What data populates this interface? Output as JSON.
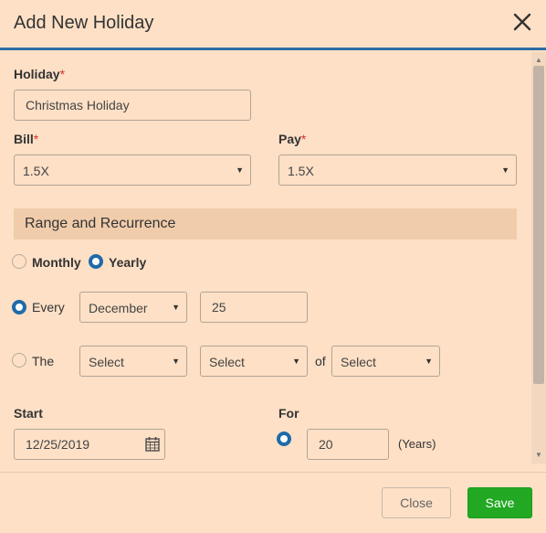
{
  "dialog": {
    "title": "Add New Holiday"
  },
  "holiday": {
    "label": "Holiday",
    "required_mark": "*",
    "value": "Christmas Holiday"
  },
  "bill": {
    "label": "Bill",
    "required_mark": "*",
    "value": "1.5X"
  },
  "pay": {
    "label": "Pay",
    "required_mark": "*",
    "value": "1.5X"
  },
  "recurrence": {
    "section_title": "Range and Recurrence",
    "monthly_label": "Monthly",
    "yearly_label": "Yearly",
    "selected_frequency": "Yearly",
    "every_label": "Every",
    "every_month": "December",
    "every_day": "25",
    "the_label": "The",
    "the_select_1": "Select",
    "the_select_2": "Select",
    "of_label": "of",
    "the_select_3": "Select",
    "selected_pattern": "Every"
  },
  "range": {
    "start_label": "Start",
    "start_value": "12/25/2019",
    "for_label": "For",
    "for_value": "20",
    "for_unit": "(Years)"
  },
  "footer": {
    "close_label": "Close",
    "save_label": "Save"
  },
  "colors": {
    "background": "#fde0c6",
    "accent": "#2c6ea3",
    "save": "#22a822",
    "required": "#d9302a"
  }
}
